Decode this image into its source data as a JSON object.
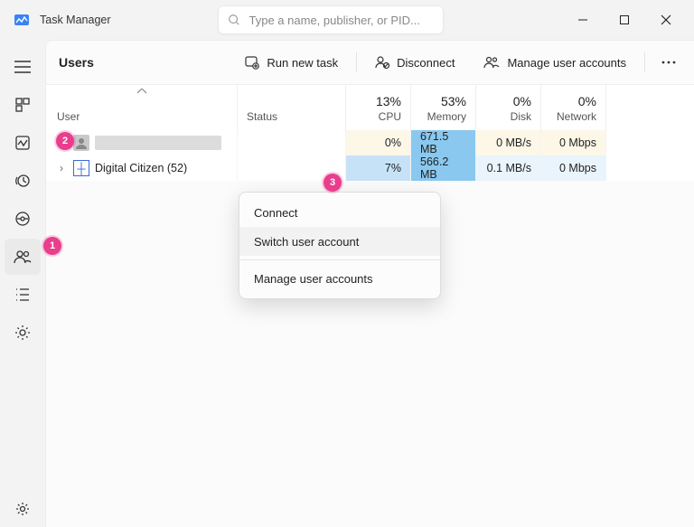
{
  "window": {
    "title": "Task Manager",
    "search_placeholder": "Type a name, publisher, or PID..."
  },
  "page": {
    "title": "Users"
  },
  "toolbar": {
    "run_new_task": "Run new task",
    "disconnect": "Disconnect",
    "manage_user_accounts": "Manage user accounts"
  },
  "columns": {
    "user": "User",
    "status": "Status",
    "cpu_pct": "13%",
    "cpu_label": "CPU",
    "mem_pct": "53%",
    "mem_label": "Memory",
    "disk_pct": "0%",
    "disk_label": "Disk",
    "net_pct": "0%",
    "net_label": "Network"
  },
  "rows": [
    {
      "expander": "∨",
      "name_redacted": true,
      "cpu": "0%",
      "memory": "671.5 MB",
      "disk": "0 MB/s",
      "network": "0 Mbps",
      "heat": {
        "cpu": "heat0",
        "mem": "heat2",
        "disk": "heat0",
        "net": "heat0"
      }
    },
    {
      "expander": "›",
      "name": "Digital Citizen (52)",
      "cpu": "7%",
      "memory": "566.2 MB",
      "disk": "0.1 MB/s",
      "network": "0 Mbps",
      "heat": {
        "cpu": "heat1",
        "mem": "heat2",
        "disk": "heat3",
        "net": "heat3"
      }
    }
  ],
  "context_menu": {
    "connect": "Connect",
    "switch_user": "Switch user account",
    "manage": "Manage user accounts"
  },
  "callouts": {
    "one": "1",
    "two": "2",
    "three": "3"
  }
}
